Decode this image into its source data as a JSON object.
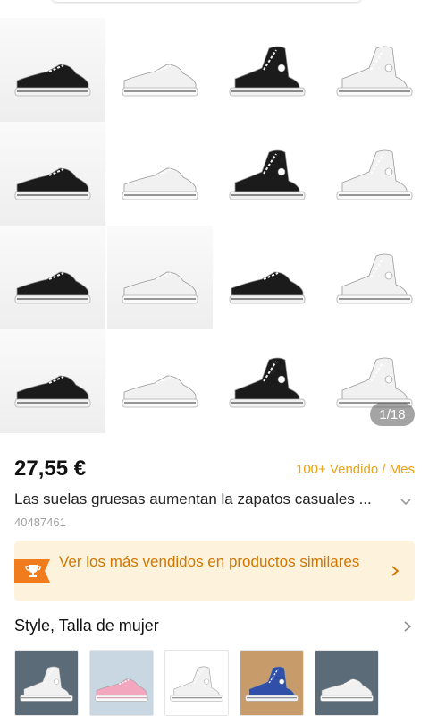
{
  "gallery": {
    "counter": "1/18",
    "items": [
      {
        "color": "black",
        "style": "low"
      },
      {
        "color": "white",
        "style": "low"
      },
      {
        "color": "black",
        "style": "high"
      },
      {
        "color": "white",
        "style": "high"
      },
      {
        "color": "black",
        "style": "low"
      },
      {
        "color": "white",
        "style": "low"
      },
      {
        "color": "black",
        "style": "high"
      },
      {
        "color": "white",
        "style": "high"
      },
      {
        "color": "black",
        "style": "low"
      },
      {
        "color": "white",
        "style": "low"
      },
      {
        "color": "black",
        "style": "low"
      },
      {
        "color": "white",
        "style": "high"
      },
      {
        "color": "black",
        "style": "low"
      },
      {
        "color": "white",
        "style": "low"
      },
      {
        "color": "black",
        "style": "high"
      },
      {
        "color": "white",
        "style": "high"
      }
    ]
  },
  "product": {
    "price": "27,55 €",
    "sold": "100+ Vendido / Mes",
    "title": "Las suelas gruesas aumentan la zapatos casuales ...",
    "id": "40487461"
  },
  "banner": {
    "text": "Ver los más vendidos en productos similares"
  },
  "style_section": {
    "title": "Style, Talla de mujer",
    "thumbnails": [
      {
        "color": "white",
        "bg": "#5b6b78",
        "style": "high"
      },
      {
        "color": "pink",
        "bg": "#c9d7e3",
        "style": "low"
      },
      {
        "color": "white",
        "bg": "#ffffff",
        "style": "high"
      },
      {
        "color": "blue",
        "bg": "#c89b6a",
        "style": "high"
      },
      {
        "color": "white",
        "bg": "#5b6b78",
        "style": "low"
      }
    ]
  },
  "colors": {
    "accent": "#e8a317",
    "banner_bg": "#fdf3dd",
    "banner_text": "#d07600",
    "trophy_badge": "#f07c1e"
  }
}
